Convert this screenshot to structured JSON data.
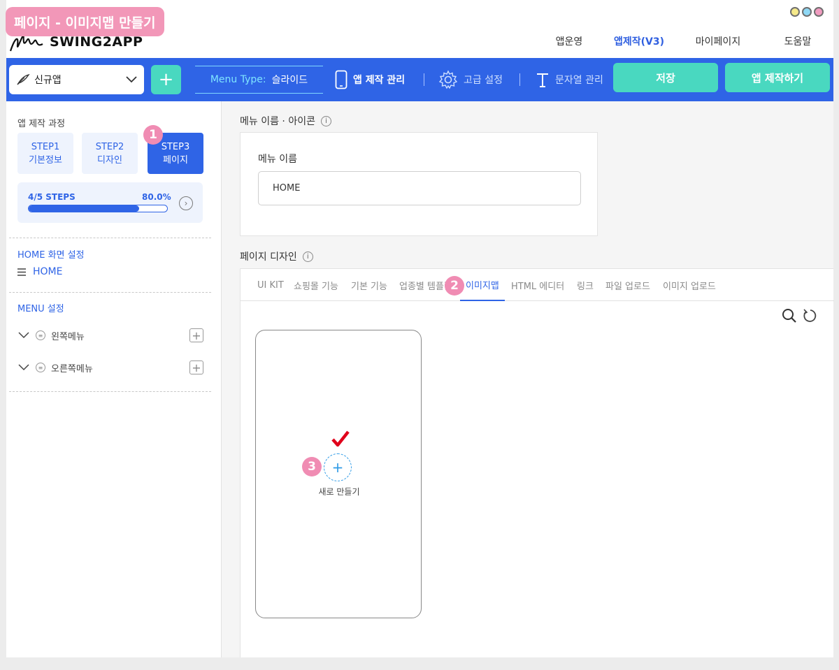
{
  "caption": "페이지 - 이미지맵 만들기",
  "brand": {
    "logo_text": "SWING2APP"
  },
  "topnav": [
    {
      "label": "앱운영",
      "active": false
    },
    {
      "label": "앱제작(V3)",
      "active": true
    },
    {
      "label": "마이페이지",
      "active": false
    },
    {
      "label": "도움말",
      "active": false
    }
  ],
  "toolbar": {
    "app_select": "신규앱",
    "add_label": "+",
    "menu_type_key": "Menu Type:",
    "menu_type_value": "슬라이드",
    "app_manage": "앱 제작 관리",
    "advanced": "고급 설정",
    "strings": "문자열 관리",
    "save": "저장",
    "make_app": "앱 제작하기"
  },
  "sidebar": {
    "process_title": "앱 제작 과정",
    "steps": [
      {
        "line1": "STEP1",
        "line2": "기본정보",
        "active": false
      },
      {
        "line1": "STEP2",
        "line2": "디자인",
        "active": false
      },
      {
        "line1": "STEP3",
        "line2": "페이지",
        "active": true
      }
    ],
    "progress_label": "4/5 STEPS",
    "progress_pct": "80.0%",
    "progress_value": 0.8,
    "home_section": "HOME 화면 설정",
    "home_item": "HOME",
    "menu_section": "MENU 설정",
    "menus": [
      {
        "label": "왼쪽메뉴"
      },
      {
        "label": "오른쪽메뉴"
      }
    ]
  },
  "badges": {
    "one": "1",
    "two": "2",
    "three": "3"
  },
  "main": {
    "menu_name_section": "메뉴 이름 · 아이콘",
    "menu_name_label": "메뉴 이름",
    "menu_name_value": "HOME",
    "page_design_section": "페이지 디자인",
    "tabs": [
      {
        "label": "UI KIT",
        "active": false
      },
      {
        "label": "쇼핑몰 기능",
        "active": false
      },
      {
        "label": "기본 기능",
        "active": false
      },
      {
        "label": "업종별 템플릿",
        "active": false
      },
      {
        "label": "이미지맵",
        "active": true
      },
      {
        "label": "HTML 에디터",
        "active": false
      },
      {
        "label": "링크",
        "active": false
      },
      {
        "label": "파일 업로드",
        "active": false
      },
      {
        "label": "이미지 업로드",
        "active": false
      }
    ],
    "new_label": "새로 만들기"
  },
  "colors": {
    "primary": "#2f64e6",
    "accent": "#49d8c0",
    "badge": "#f08cb3",
    "check": "#e0001b"
  }
}
